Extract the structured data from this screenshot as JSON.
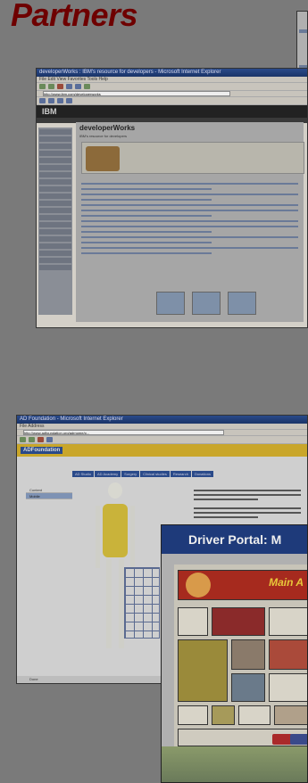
{
  "slide": {
    "title": "Partners"
  },
  "window_devworks": {
    "title": "developerWorks : IBM's resource for developers - Microsoft Internet Explorer",
    "menu": "File  Edit  View  Favorites  Tools  Help",
    "address": "http://www.ibm.com/developerworks",
    "logo": "IBM",
    "page_title": "developerWorks",
    "page_subtitle": "IBM's resource for developers"
  },
  "window_ad": {
    "title": "AD Foundation - Microsoft Internet Explorer",
    "menu": "File  Address",
    "address": "http://www.adfoundation.org/adrnome/p...",
    "logo": "ADFoundation",
    "tabs": [
      "AD Studio",
      "AD Academy",
      "Surgery",
      "Clinical studies",
      "Research",
      "Donations"
    ],
    "side_items": [
      "Content",
      "Mobile"
    ],
    "status": "Done"
  },
  "window_driver": {
    "title": "Driver Portal:  M",
    "banner": "Main A"
  }
}
